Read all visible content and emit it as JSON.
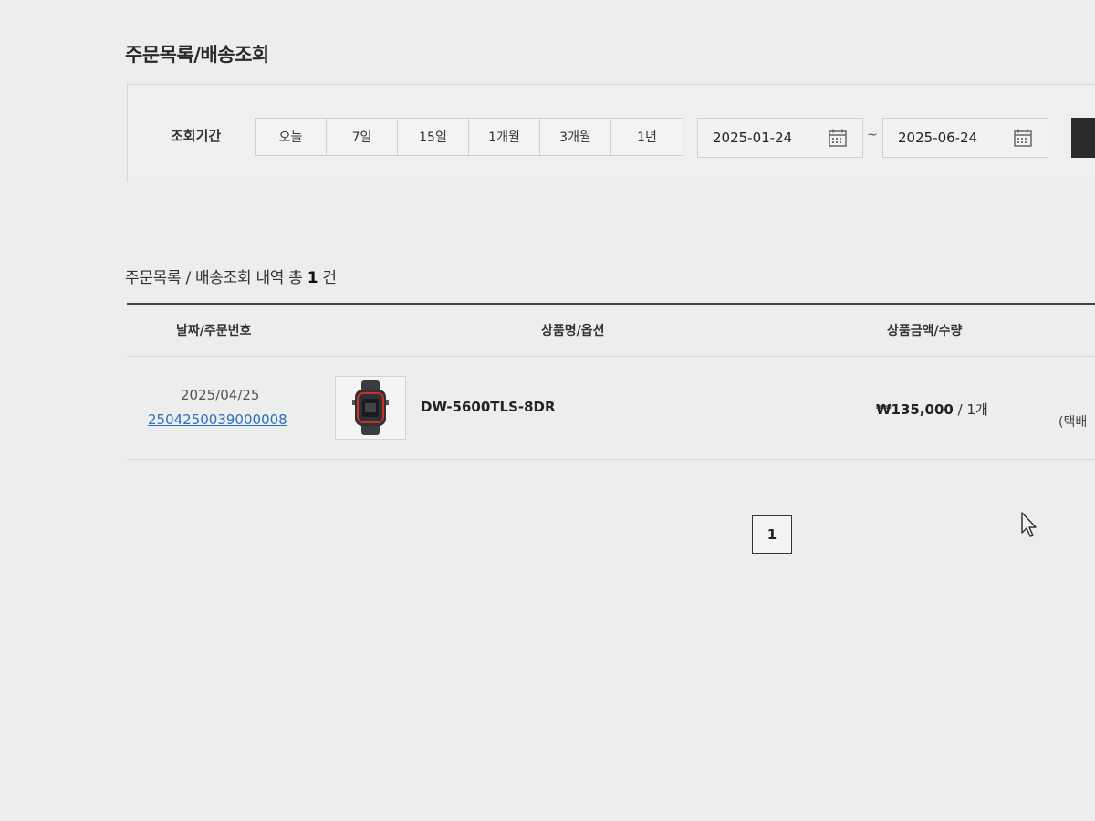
{
  "page": {
    "title": "주문목록/배송조회"
  },
  "filter": {
    "label": "조회기간",
    "periods": [
      "오늘",
      "7일",
      "15일",
      "1개월",
      "3개월",
      "1년"
    ],
    "start_date": "2025-01-24",
    "separator": "~",
    "end_date": "2025-06-24",
    "calendar_icon": "calendar-icon"
  },
  "summary": {
    "prefix": "주문목록 / 배송조회 내역 총",
    "count": "1",
    "suffix": "건"
  },
  "table": {
    "headers": {
      "date_order": "날짜/주문번호",
      "product": "상품명/옵션",
      "price_qty": "상품금액/수량"
    },
    "rows": [
      {
        "date": "2025/04/25",
        "order_number": "2504250039000008",
        "product_name": "DW-5600TLS-8DR",
        "product_image": "watch-image",
        "price": "₩135,000",
        "qty_sep": " / ",
        "qty": "1개",
        "shipping": "(택배"
      }
    ]
  },
  "pagination": {
    "current_page": "1"
  },
  "colors": {
    "link": "#2a6fc0",
    "background": "#eceeed",
    "table_top_line": "#444444",
    "search_button": "#2b2b2b"
  }
}
